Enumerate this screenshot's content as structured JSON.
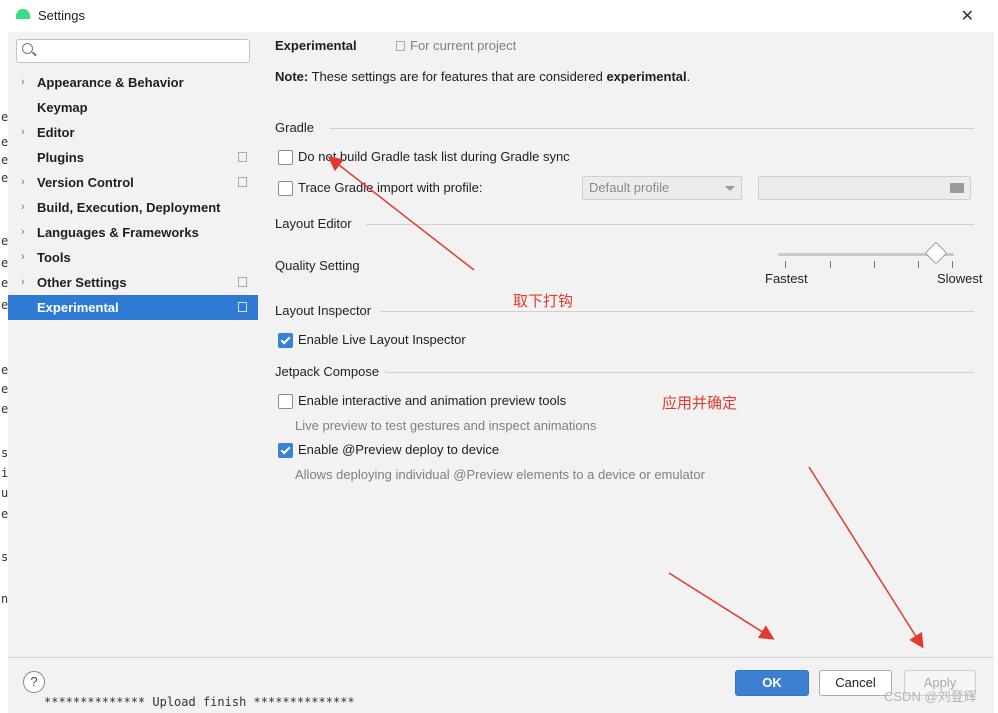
{
  "window": {
    "title": "Settings",
    "close_glyph": "✕"
  },
  "search": {
    "placeholder": "",
    "icon": "search-icon"
  },
  "sidebar": {
    "items": [
      {
        "label": "Appearance & Behavior",
        "expandable": true,
        "project": false,
        "selected": false
      },
      {
        "label": "Keymap",
        "expandable": false,
        "project": false,
        "selected": false
      },
      {
        "label": "Editor",
        "expandable": true,
        "project": false,
        "selected": false
      },
      {
        "label": "Plugins",
        "expandable": false,
        "project": true,
        "selected": false
      },
      {
        "label": "Version Control",
        "expandable": true,
        "project": true,
        "selected": false
      },
      {
        "label": "Build, Execution, Deployment",
        "expandable": true,
        "project": false,
        "selected": false
      },
      {
        "label": "Languages & Frameworks",
        "expandable": true,
        "project": false,
        "selected": false
      },
      {
        "label": "Tools",
        "expandable": true,
        "project": false,
        "selected": false
      },
      {
        "label": "Other Settings",
        "expandable": true,
        "project": true,
        "selected": false
      },
      {
        "label": "Experimental",
        "expandable": false,
        "project": true,
        "selected": true
      }
    ]
  },
  "main": {
    "breadcrumb": "Experimental",
    "scope": "For current project",
    "note": {
      "prefix": "Note:",
      "text": " These settings are for features that are considered ",
      "emph": "experimental",
      "suffix": "."
    },
    "gradle": {
      "title": "Gradle",
      "skip_task_list": {
        "label": "Do not build Gradle task list during Gradle sync",
        "checked": false
      },
      "trace_import": {
        "label": "Trace Gradle import with profile:",
        "checked": false
      },
      "profile_dropdown": "Default profile"
    },
    "layout_editor": {
      "title": "Layout Editor",
      "quality_label": "Quality Setting",
      "slider_min": "Fastest",
      "slider_max": "Slowest",
      "slider_value": 1.0
    },
    "layout_inspector": {
      "title": "Layout Inspector",
      "live": {
        "label": "Enable Live Layout Inspector",
        "checked": true
      }
    },
    "compose": {
      "title": "Jetpack Compose",
      "interactive": {
        "label": "Enable interactive and animation preview tools",
        "checked": false,
        "hint": "Live preview to test gestures and inspect animations"
      },
      "deploy": {
        "label": "Enable @Preview deploy to device",
        "checked": true,
        "hint": "Allows deploying individual @Preview elements to a device or emulator"
      }
    }
  },
  "annotations": {
    "uncheck": "取下打钩",
    "apply": "应用并确定",
    "color": "#e23b2e"
  },
  "footer": {
    "help": "?",
    "ok": "OK",
    "cancel": "Cancel",
    "apply": "Apply"
  },
  "background": {
    "console": "************** Upload finish **************",
    "watermark": "CSDN @刘登辉"
  },
  "colors": {
    "selection": "#2f7bd3",
    "ok_button": "#3d80d3",
    "checkbox": "#3a82d8"
  }
}
